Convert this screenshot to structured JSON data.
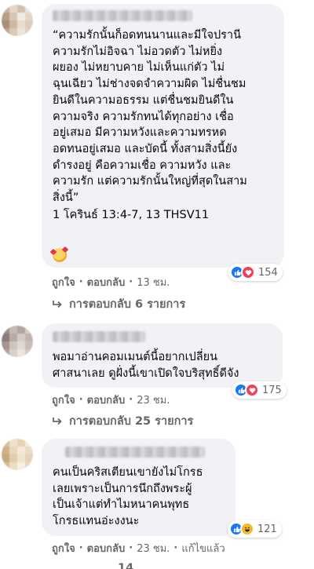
{
  "comments": [
    {
      "lines": [
        "“ความรักนั้นก็อดทนนานและมีใจปรานี",
        "ความรักไม่อิจฉา ไม่อวดตัว ไม่หยิ่ง",
        "ผยอง ไม่หยาบคาย ไม่เห็นแก่ตัว ไม่",
        "ฉุนเฉียว ไม่ช่างจดจำความผิด ไม่ชื่นชม",
        "ยินดีในความอธรรม แต่ชื่นชมยินดีใน",
        "ความจริง ความรักทนได้ทุกอย่าง เชื่อ",
        "อยู่เสมอ มีความหวังและความทรหด",
        "อดทนอยู่เสมอ และบัดนี้ ทั้งสามสิ่งนี้ยัง",
        "ดำรงอยู่ คือความเชื่อ ความหวัง และ",
        "ความรัก แต่ความรักนั้นใหญ่ที่สุดในสาม",
        "สิ่งนี้”"
      ],
      "reference": "1 โครินธ์ 13:4-7, 13 THSV11",
      "like_label": "ถูกใจ",
      "reply_label": "ตอบกลับ",
      "time": "13 ชม.",
      "reaction_count": "154",
      "replies_label": "การตอบกลับ 6 รายการ"
    },
    {
      "lines": [
        "พอมาอ่านคอมเมนต์นี้อยากเปลี่ยน",
        "ศาสนาเลย ดูฝั่งนี้เขาเปิดใจบริสุทธิ์ดีจัง"
      ],
      "like_label": "ถูกใจ",
      "reply_label": "ตอบกลับ",
      "time": "23 ชม.",
      "reaction_count": "175",
      "replies_label": "การตอบกลับ 25 รายการ"
    },
    {
      "lines": [
        "คนเป็นคริสเตียนเขายังไม่โกรธ",
        "เลยเพราะเป็นการนึกถึงพระผู้",
        "เป็นเจ้าแต่ทำไมหนาคนพุทธ",
        "โกรธแทนอ่ะงงนะ"
      ],
      "like_label": "ถูกใจ",
      "reply_label": "ตอบกลับ",
      "time": "23 ชม.",
      "edited_label": "แก้ไขแล้ว",
      "reaction_count": "121"
    }
  ],
  "partial_bottom_text": "14"
}
